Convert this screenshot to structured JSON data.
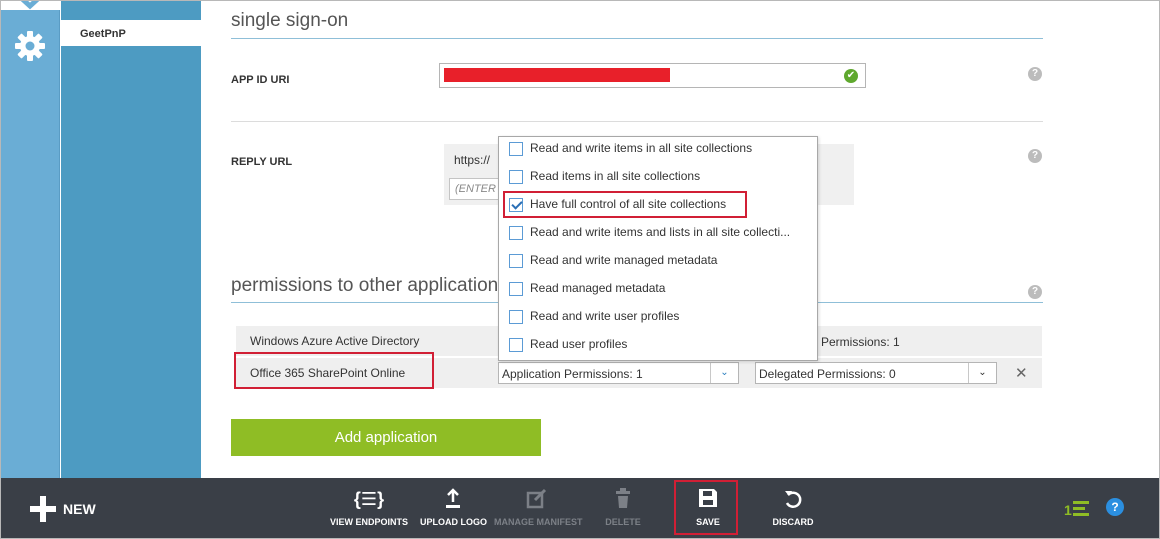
{
  "sidebar": {
    "subnav_item": "GeetPnP"
  },
  "sso": {
    "title": "single sign-on",
    "app_id_label": "APP ID URI",
    "reply_url_label": "REPLY URL",
    "reply_url_value": "https://",
    "reply_placeholder": "(ENTER",
    "help": "?"
  },
  "permissions": {
    "title": "permissions to other applications",
    "rows": [
      {
        "name": "Windows Azure Active Directory",
        "delegated": "Permissions: 1"
      },
      {
        "name": "Office 365 SharePoint Online",
        "app_select": "Application Permissions: 1",
        "delegated_select": "Delegated Permissions: 0"
      }
    ],
    "remove": "✕"
  },
  "dropdown": {
    "options": [
      {
        "label": "Read and write items in all site collections",
        "checked": false
      },
      {
        "label": "Read items in all site collections",
        "checked": false
      },
      {
        "label": "Have full control of all site collections",
        "checked": true
      },
      {
        "label": "Read and write items and lists in all site collecti...",
        "checked": false
      },
      {
        "label": "Read and write managed metadata",
        "checked": false
      },
      {
        "label": "Read managed metadata",
        "checked": false
      },
      {
        "label": "Read and write user profiles",
        "checked": false
      },
      {
        "label": "Read user profiles",
        "checked": false
      }
    ]
  },
  "add_application": "Add application",
  "commandbar": {
    "new": "NEW",
    "view_endpoints": "VIEW ENDPOINTS",
    "upload_logo": "UPLOAD LOGO",
    "manage_manifest": "MANAGE MANIFEST",
    "delete": "DELETE",
    "save": "SAVE",
    "discard": "DISCARD",
    "logo_number": "1",
    "help": "?"
  },
  "colors": {
    "rail": "#6aadd5",
    "subnav": "#4d9bc2",
    "accent_green": "#8fbd25",
    "commandbar": "#3a3f47",
    "highlight_red": "#d11f35"
  }
}
